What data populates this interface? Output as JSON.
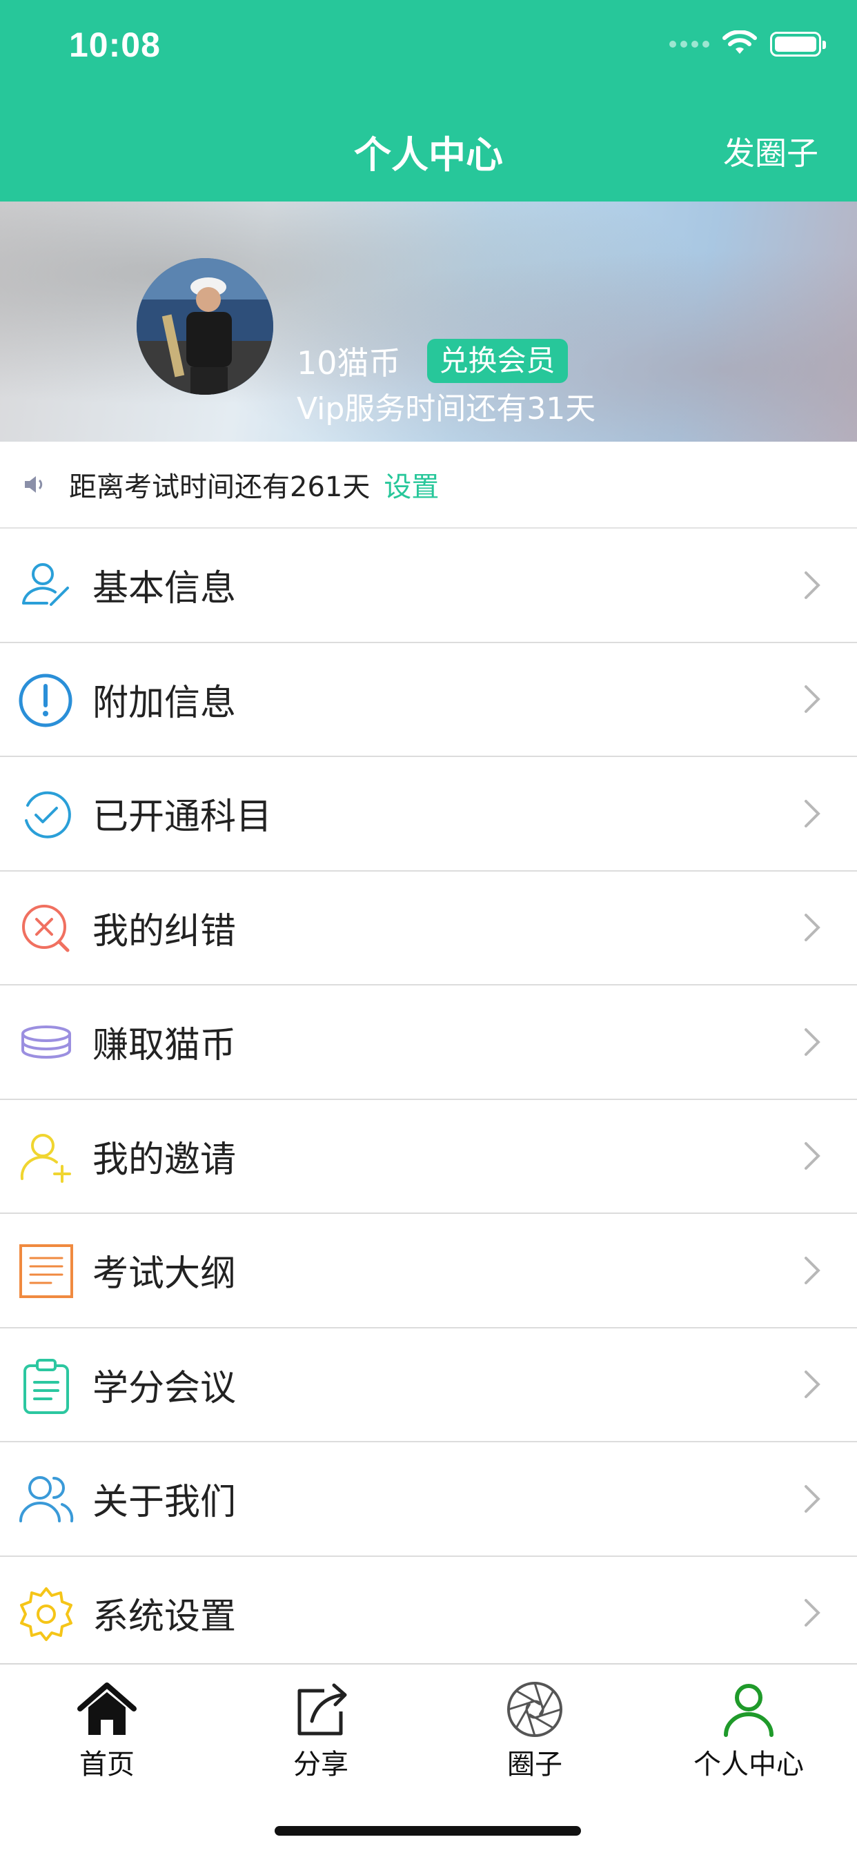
{
  "status_bar": {
    "time": "10:08"
  },
  "header": {
    "title": "个人中心",
    "post_label": "发圈子"
  },
  "profile": {
    "coins": "10猫币",
    "exchange_label": "兑换会员",
    "vip_text": "Vip服务时间还有31天"
  },
  "notice": {
    "text": "距离考试时间还有261天",
    "action": "设置"
  },
  "menu": {
    "items": [
      {
        "label": "基本信息",
        "icon": "user-edit-icon",
        "color": "#2a9fd8"
      },
      {
        "label": "附加信息",
        "icon": "exclamation-circle-icon",
        "color": "#2a8fd8"
      },
      {
        "label": "已开通科目",
        "icon": "check-circle-icon",
        "color": "#2a9fd8"
      },
      {
        "label": "我的纠错",
        "icon": "error-search-icon",
        "color": "#f07060"
      },
      {
        "label": "赚取猫币",
        "icon": "coin-stack-icon",
        "color": "#9b8fe0"
      },
      {
        "label": "我的邀请",
        "icon": "user-add-icon",
        "color": "#f0d530"
      },
      {
        "label": "考试大纲",
        "icon": "document-icon",
        "color": "#f08a40"
      },
      {
        "label": "学分会议",
        "icon": "clipboard-icon",
        "color": "#2cc7a0"
      },
      {
        "label": "关于我们",
        "icon": "users-icon",
        "color": "#3a9ad8"
      },
      {
        "label": "系统设置",
        "icon": "gear-icon",
        "color": "#f5c518"
      }
    ]
  },
  "tabbar": {
    "tabs": [
      {
        "label": "首页",
        "icon": "home-icon"
      },
      {
        "label": "分享",
        "icon": "share-icon"
      },
      {
        "label": "圈子",
        "icon": "aperture-icon"
      },
      {
        "label": "个人中心",
        "icon": "user-icon",
        "active": true
      }
    ]
  },
  "colors": {
    "brand": "#27c79a",
    "active_tab": "#1f9a2a"
  }
}
